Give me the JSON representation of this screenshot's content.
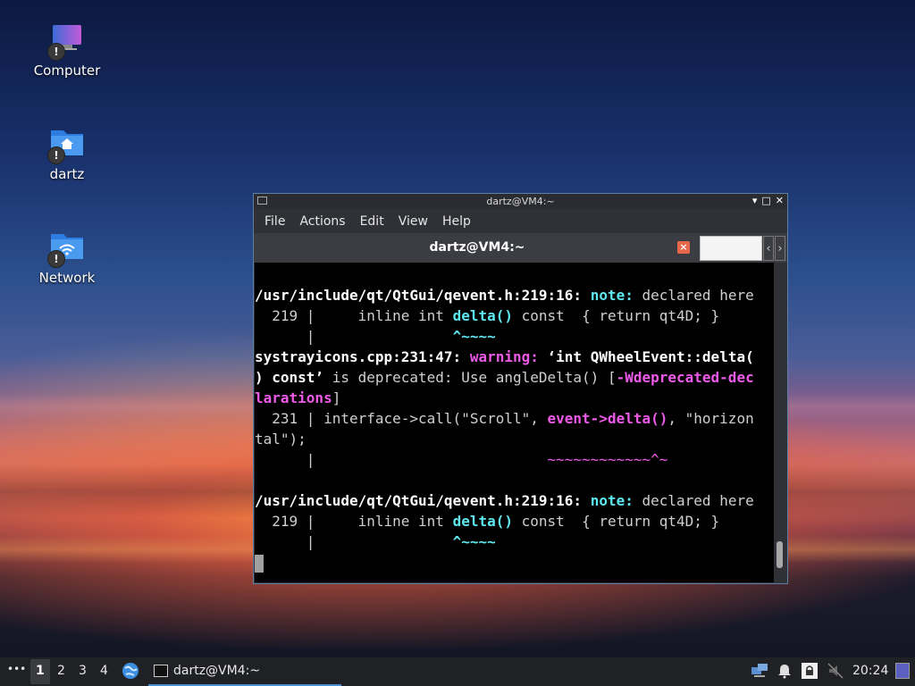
{
  "desktop": {
    "icons": [
      {
        "label": "Computer",
        "icon": "computer-icon"
      },
      {
        "label": "dartz",
        "icon": "home-folder-icon"
      },
      {
        "label": "Network",
        "icon": "network-folder-icon"
      }
    ],
    "badge": "!"
  },
  "window": {
    "title": "dartz@VM4:~",
    "controls": {
      "minimize": "▾",
      "maximize": "□",
      "close": "✕"
    },
    "menu": [
      "File",
      "Actions",
      "Edit",
      "View",
      "Help"
    ],
    "tab": {
      "title": "dartz@VM4:~",
      "close_glyph": "×",
      "left_arrow": "‹",
      "right_arrow": "›"
    },
    "console": {
      "lines": [
        "",
        "/usr/include/qt/QtGui/qevent.h:219:16: note: declared here",
        "  219 |     inline int delta() const  { return qt4D; }",
        "      |                ^~~~~",
        "systrayicons.cpp:231:47: warning: ‘int QWheelEvent::delta(",
        ") const’ is deprecated: Use angleDelta() [-Wdeprecated-dec",
        "larations]",
        "  231 | interface->call(\"Scroll\", event->delta(), \"horizon",
        "tal\");",
        "      |                           ~~~~~~~~~~~~^~",
        "",
        "/usr/include/qt/QtGui/qevent.h:219:16: note: declared here",
        "  219 |     inline int delta() const  { return qt4D; }",
        "      |                ^~~~~",
        ""
      ]
    }
  },
  "taskbar": {
    "menu_glyph": "•••",
    "workspaces": [
      "1",
      "2",
      "3",
      "4"
    ],
    "active_workspace": "1",
    "task_label": "dartz@VM4:~",
    "clock": "20:24"
  }
}
